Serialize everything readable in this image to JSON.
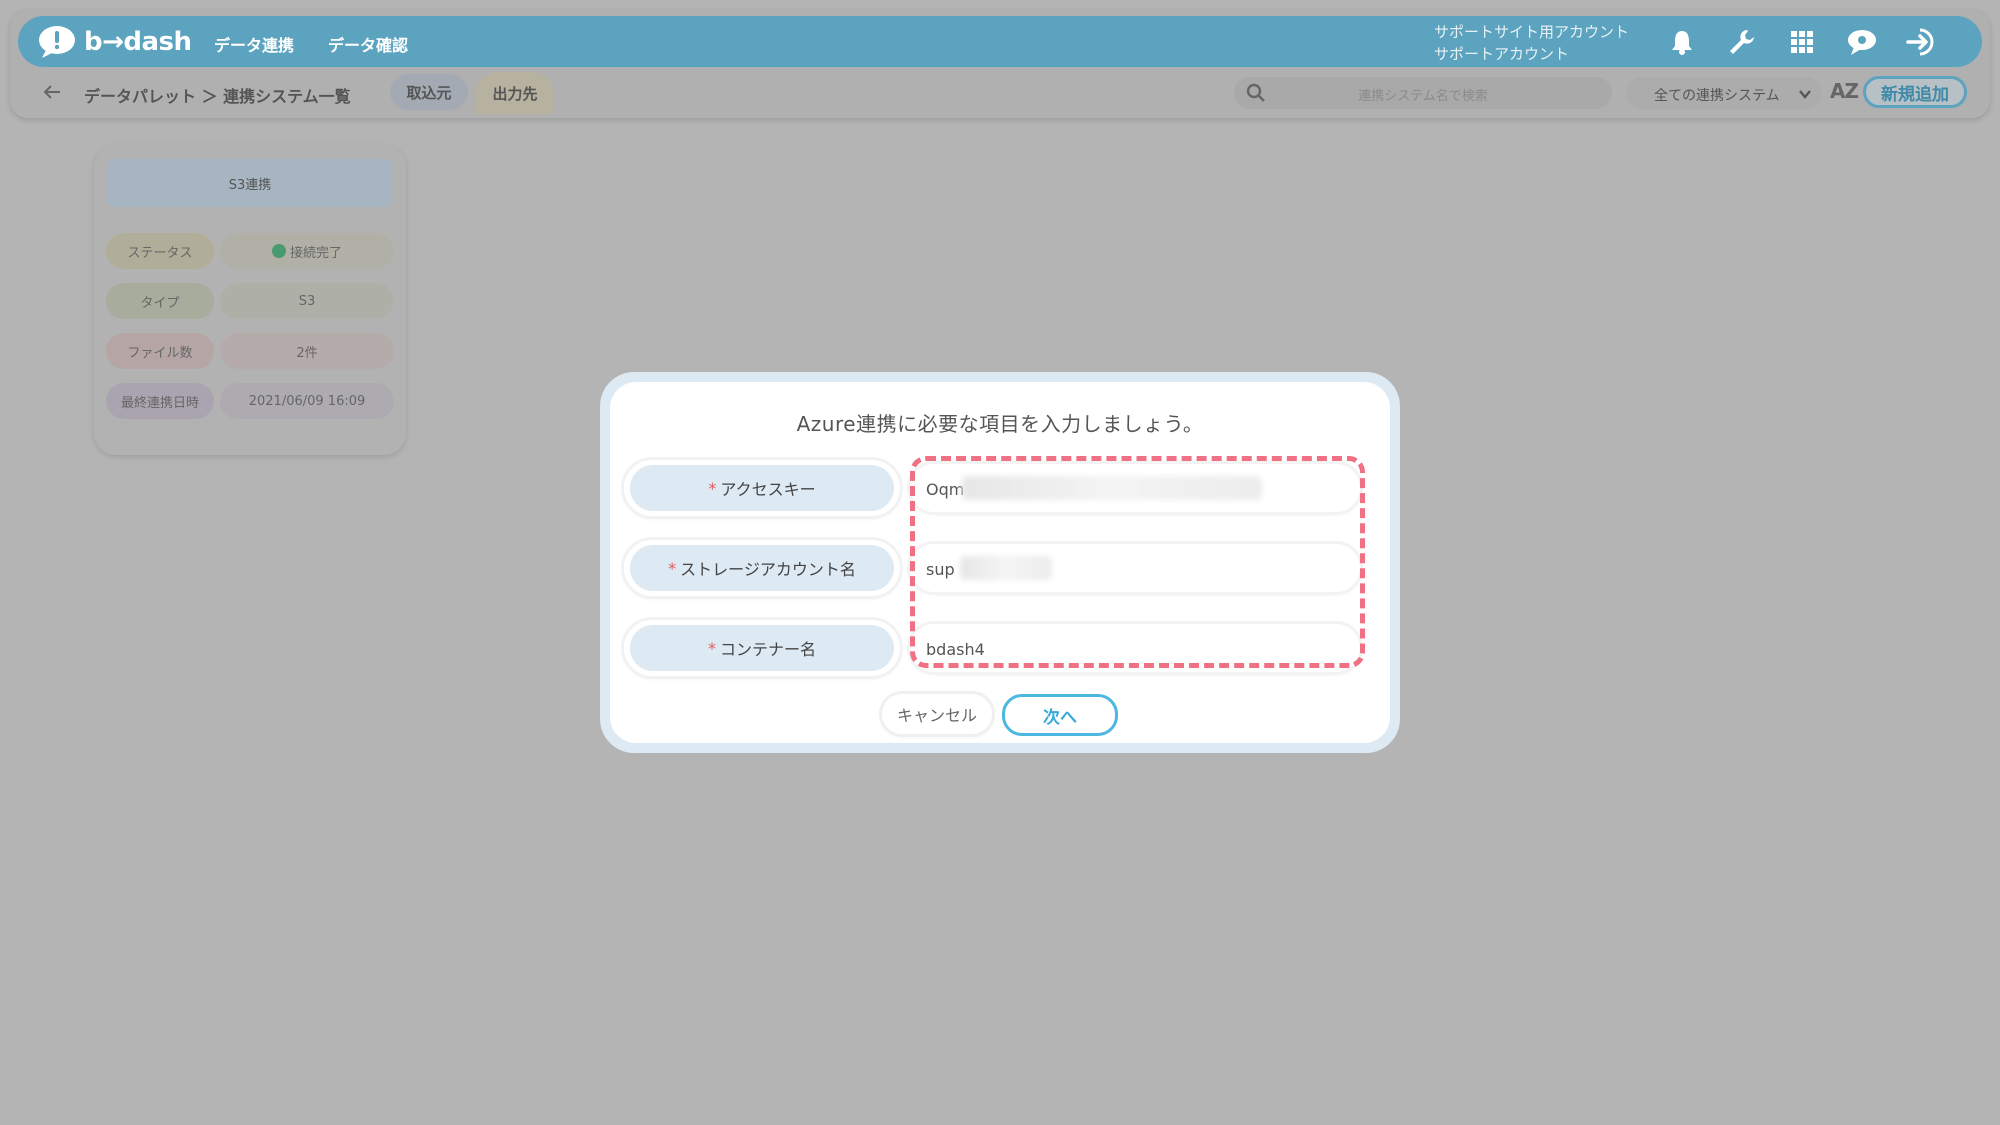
{
  "header": {
    "logo_text": "b→dash",
    "nav": [
      "データ連携",
      "データ確認"
    ],
    "account_line1": "サポートサイト用アカウント",
    "account_line2": "サポートアカウント",
    "icons": [
      "bell-icon",
      "wrench-icon",
      "grid-icon",
      "chat-icon",
      "logout-icon"
    ],
    "brand_color": "#5ca3c0"
  },
  "subbar": {
    "breadcrumb": "データパレット ＞ 連携システム一覧",
    "tab_import": "取込元",
    "tab_output": "出力先",
    "search_placeholder": "連携システム名で検索",
    "filter_value": "全ての連携システム",
    "sort_label": "AZ",
    "add_button": "新規追加"
  },
  "card": {
    "title": "S3連携",
    "rows": [
      {
        "label": "ステータス",
        "value": "接続完了",
        "label_color": "#b0ad98",
        "value_color": "#b1b0a6"
      },
      {
        "label": "タイプ",
        "value": "S3",
        "label_color": "#a7ac9c",
        "value_color": "#aeb0a8"
      },
      {
        "label": "ファイル数",
        "value": "2件",
        "label_color": "#b5a5a5",
        "value_color": "#b5abab"
      },
      {
        "label": "最終連携日時",
        "value": "2021/06/09 16:09",
        "label_color": "#aaa4b0",
        "value_color": "#adabb0"
      }
    ]
  },
  "modal": {
    "title": "Azure連携に必要な項目を入力しましょう。",
    "required_mark": "*",
    "fields": [
      {
        "label": "アクセスキー",
        "value": "Oqm"
      },
      {
        "label": "ストレージアカウント名",
        "value": "sup"
      },
      {
        "label": "コンテナー名",
        "value": "bdash4"
      }
    ],
    "cancel_label": "キャンセル",
    "next_label": "次へ",
    "highlight_color": "#f07183"
  }
}
